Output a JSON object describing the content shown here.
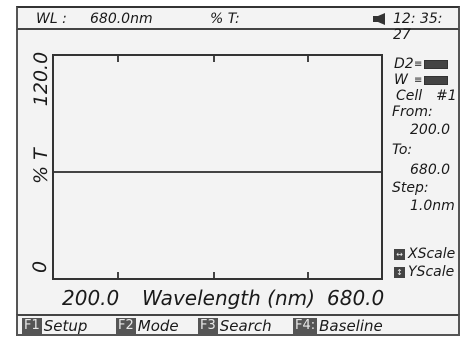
{
  "status": {
    "wl_label": "WL :",
    "wl_value": "680.0nm",
    "t_label": "% T:",
    "t_value": "",
    "time": "12: 35: 27"
  },
  "plot": {
    "y_max": "120.0",
    "y_min": "0",
    "y_label": "% T",
    "x_min": "200.0",
    "x_max": "680.0",
    "x_label": "Wavelength (nm)"
  },
  "side": {
    "d2_label": "D2",
    "w_label": "W",
    "cell_label": "Cell",
    "cell_value": "#1",
    "from_label": "From:",
    "from_value": "200.0",
    "to_label": "To:",
    "to_value": "680.0",
    "step_label": "Step:",
    "step_value": "1.0nm",
    "xscale_label": "XScale",
    "yscale_label": "YScale"
  },
  "fn": [
    {
      "key": "F1",
      "label": "Setup"
    },
    {
      "key": "F2",
      "label": "Mode"
    },
    {
      "key": "F3",
      "label": "Search"
    },
    {
      "key": "F4:",
      "label": "Baseline"
    }
  ],
  "icons": {
    "speaker": "speaker-icon",
    "lamp_d2": "lamp-d2-icon",
    "lamp_w": "lamp-w-icon",
    "xscale": "xscale-icon",
    "yscale": "yscale-icon"
  }
}
